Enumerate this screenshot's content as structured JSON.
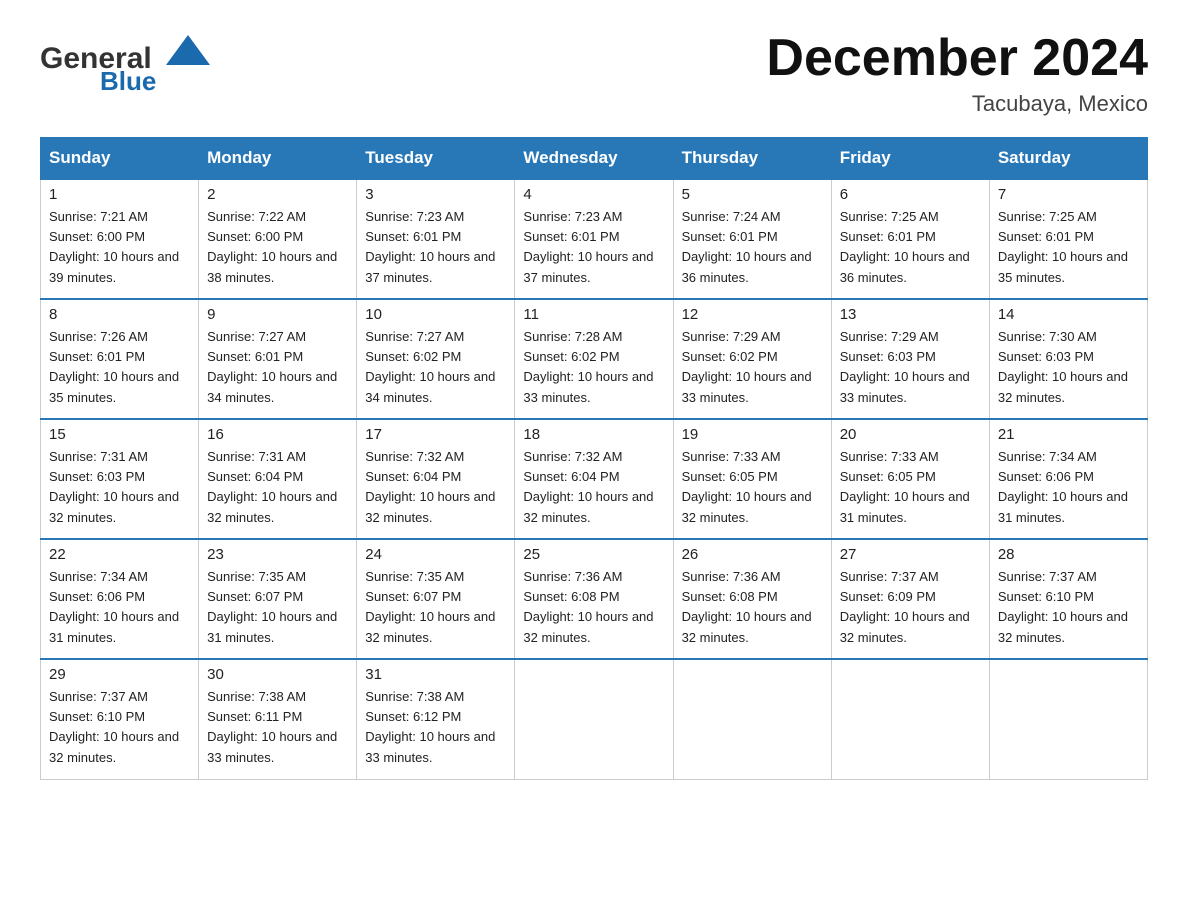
{
  "header": {
    "logo_general": "General",
    "logo_blue": "Blue",
    "month_title": "December 2024",
    "location": "Tacubaya, Mexico"
  },
  "days_of_week": [
    "Sunday",
    "Monday",
    "Tuesday",
    "Wednesday",
    "Thursday",
    "Friday",
    "Saturday"
  ],
  "weeks": [
    [
      {
        "day": "1",
        "sunrise": "7:21 AM",
        "sunset": "6:00 PM",
        "daylight": "10 hours and 39 minutes."
      },
      {
        "day": "2",
        "sunrise": "7:22 AM",
        "sunset": "6:00 PM",
        "daylight": "10 hours and 38 minutes."
      },
      {
        "day": "3",
        "sunrise": "7:23 AM",
        "sunset": "6:01 PM",
        "daylight": "10 hours and 37 minutes."
      },
      {
        "day": "4",
        "sunrise": "7:23 AM",
        "sunset": "6:01 PM",
        "daylight": "10 hours and 37 minutes."
      },
      {
        "day": "5",
        "sunrise": "7:24 AM",
        "sunset": "6:01 PM",
        "daylight": "10 hours and 36 minutes."
      },
      {
        "day": "6",
        "sunrise": "7:25 AM",
        "sunset": "6:01 PM",
        "daylight": "10 hours and 36 minutes."
      },
      {
        "day": "7",
        "sunrise": "7:25 AM",
        "sunset": "6:01 PM",
        "daylight": "10 hours and 35 minutes."
      }
    ],
    [
      {
        "day": "8",
        "sunrise": "7:26 AM",
        "sunset": "6:01 PM",
        "daylight": "10 hours and 35 minutes."
      },
      {
        "day": "9",
        "sunrise": "7:27 AM",
        "sunset": "6:01 PM",
        "daylight": "10 hours and 34 minutes."
      },
      {
        "day": "10",
        "sunrise": "7:27 AM",
        "sunset": "6:02 PM",
        "daylight": "10 hours and 34 minutes."
      },
      {
        "day": "11",
        "sunrise": "7:28 AM",
        "sunset": "6:02 PM",
        "daylight": "10 hours and 33 minutes."
      },
      {
        "day": "12",
        "sunrise": "7:29 AM",
        "sunset": "6:02 PM",
        "daylight": "10 hours and 33 minutes."
      },
      {
        "day": "13",
        "sunrise": "7:29 AM",
        "sunset": "6:03 PM",
        "daylight": "10 hours and 33 minutes."
      },
      {
        "day": "14",
        "sunrise": "7:30 AM",
        "sunset": "6:03 PM",
        "daylight": "10 hours and 32 minutes."
      }
    ],
    [
      {
        "day": "15",
        "sunrise": "7:31 AM",
        "sunset": "6:03 PM",
        "daylight": "10 hours and 32 minutes."
      },
      {
        "day": "16",
        "sunrise": "7:31 AM",
        "sunset": "6:04 PM",
        "daylight": "10 hours and 32 minutes."
      },
      {
        "day": "17",
        "sunrise": "7:32 AM",
        "sunset": "6:04 PM",
        "daylight": "10 hours and 32 minutes."
      },
      {
        "day": "18",
        "sunrise": "7:32 AM",
        "sunset": "6:04 PM",
        "daylight": "10 hours and 32 minutes."
      },
      {
        "day": "19",
        "sunrise": "7:33 AM",
        "sunset": "6:05 PM",
        "daylight": "10 hours and 32 minutes."
      },
      {
        "day": "20",
        "sunrise": "7:33 AM",
        "sunset": "6:05 PM",
        "daylight": "10 hours and 31 minutes."
      },
      {
        "day": "21",
        "sunrise": "7:34 AM",
        "sunset": "6:06 PM",
        "daylight": "10 hours and 31 minutes."
      }
    ],
    [
      {
        "day": "22",
        "sunrise": "7:34 AM",
        "sunset": "6:06 PM",
        "daylight": "10 hours and 31 minutes."
      },
      {
        "day": "23",
        "sunrise": "7:35 AM",
        "sunset": "6:07 PM",
        "daylight": "10 hours and 31 minutes."
      },
      {
        "day": "24",
        "sunrise": "7:35 AM",
        "sunset": "6:07 PM",
        "daylight": "10 hours and 32 minutes."
      },
      {
        "day": "25",
        "sunrise": "7:36 AM",
        "sunset": "6:08 PM",
        "daylight": "10 hours and 32 minutes."
      },
      {
        "day": "26",
        "sunrise": "7:36 AM",
        "sunset": "6:08 PM",
        "daylight": "10 hours and 32 minutes."
      },
      {
        "day": "27",
        "sunrise": "7:37 AM",
        "sunset": "6:09 PM",
        "daylight": "10 hours and 32 minutes."
      },
      {
        "day": "28",
        "sunrise": "7:37 AM",
        "sunset": "6:10 PM",
        "daylight": "10 hours and 32 minutes."
      }
    ],
    [
      {
        "day": "29",
        "sunrise": "7:37 AM",
        "sunset": "6:10 PM",
        "daylight": "10 hours and 32 minutes."
      },
      {
        "day": "30",
        "sunrise": "7:38 AM",
        "sunset": "6:11 PM",
        "daylight": "10 hours and 33 minutes."
      },
      {
        "day": "31",
        "sunrise": "7:38 AM",
        "sunset": "6:12 PM",
        "daylight": "10 hours and 33 minutes."
      },
      null,
      null,
      null,
      null
    ]
  ]
}
